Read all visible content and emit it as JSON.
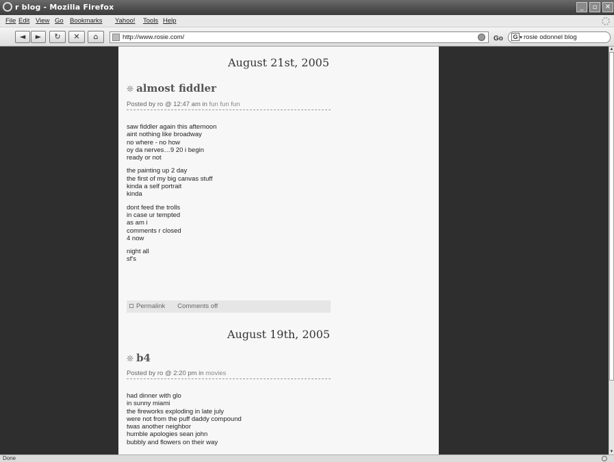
{
  "window": {
    "title": "r blog - Mozilla Firefox",
    "minimize": "_",
    "maximize": "▫",
    "close": "✕"
  },
  "menu": [
    "File",
    "Edit",
    "View",
    "Go",
    "Bookmarks",
    "Yahoo!",
    "Tools",
    "Help"
  ],
  "toolbar": {
    "back": "◄",
    "forward": "►",
    "reload": "↻",
    "stop": "✕",
    "home": "⌂",
    "url": "http://www.rosie.com/",
    "go_label": "Go",
    "search_engine": "G",
    "search_value": "rosie odonnel blog"
  },
  "posts": [
    {
      "date": "August 21st, 2005",
      "title": "almost fiddler",
      "meta_prefix": "Posted by ro @ 12:47 am in ",
      "category": "fun fun fun",
      "paragraphs": [
        "saw fiddler again this afternoon\naint nothing like broadway\nno where - no how\noy da nerves…9 20 i begin\nready or not",
        "the painting up 2 day\nthe first of my big canvas stuff\nkinda a self portrait\nkinda",
        "dont feed the trolls\nin case ur tempted\nas am i\ncomments r closed\n4 now",
        "night all\nsf's"
      ],
      "permalink": "Permalink",
      "comments": "Comments off"
    },
    {
      "date": "August 19th, 2005",
      "title": "b4",
      "meta_prefix": "Posted by ro @ 2:20 pm in ",
      "category": "movies",
      "paragraphs": [
        "had dinner with glo\nin sunny miami\nthe fireworks exploding in late july\nwere not from the puff daddy compound\ntwas another neighbor\nhumble apologies sean john\nbubbly and flowers on their way"
      ]
    }
  ],
  "status": {
    "text": "Done"
  },
  "icons": {
    "bullet": "❊",
    "permalink_marker": "square-icon"
  }
}
